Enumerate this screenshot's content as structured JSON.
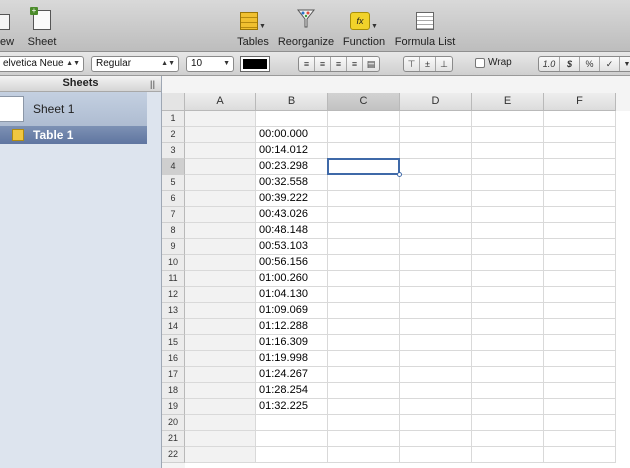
{
  "toolbar": {
    "items": [
      {
        "label": "ew",
        "icon": "view-icon"
      },
      {
        "label": "Sheet",
        "icon": "sheet-icon"
      },
      {
        "label": "Tables",
        "icon": "tables-icon"
      },
      {
        "label": "Reorganize",
        "icon": "reorganize-icon"
      },
      {
        "label": "Function",
        "icon": "function-icon"
      },
      {
        "label": "Formula List",
        "icon": "formula-list-icon"
      }
    ]
  },
  "formatbar": {
    "font_family": "elvetica Neue",
    "font_style": "Regular",
    "font_size": "10",
    "text_color": "#000000",
    "wrap_label": "Wrap",
    "number_buttons": [
      "1.0",
      "$",
      "%",
      "✓"
    ]
  },
  "sidebar": {
    "header": "Sheets",
    "sheet_name": "Sheet 1",
    "table_name": "Table 1"
  },
  "grid": {
    "columns": [
      "A",
      "B",
      "C",
      "D",
      "E",
      "F"
    ],
    "selected_column": "C",
    "selected_row": 4,
    "rows": [
      "1",
      "2",
      "3",
      "4",
      "5",
      "6",
      "7",
      "8",
      "9",
      "10",
      "11",
      "12",
      "13",
      "14",
      "15",
      "16",
      "17",
      "18",
      "19",
      "20",
      "21",
      "22"
    ],
    "column_b_values": [
      "",
      "00:00.000",
      "00:14.012",
      "00:23.298",
      "00:32.558",
      "00:39.222",
      "00:43.026",
      "00:48.148",
      "00:53.103",
      "00:56.156",
      "01:00.260",
      "01:04.130",
      "01:09.069",
      "01:12.288",
      "01:16.309",
      "01:19.998",
      "01:24.267",
      "01:28.254",
      "01:32.225",
      "",
      "",
      ""
    ]
  }
}
